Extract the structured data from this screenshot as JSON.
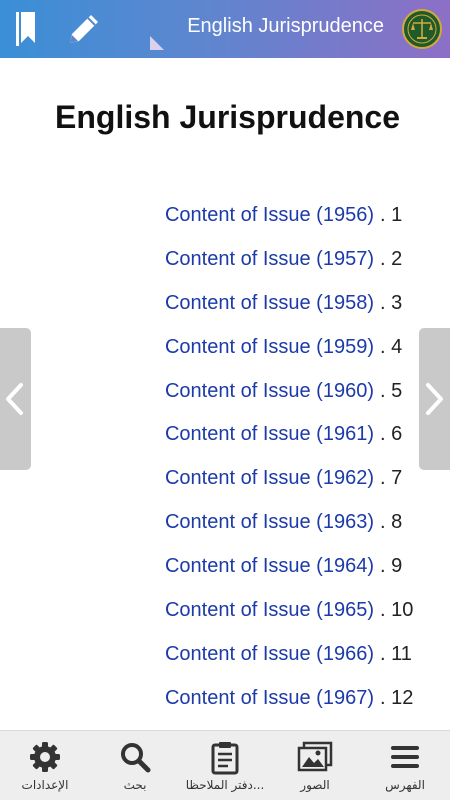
{
  "header": {
    "title": "English Jurisprudence",
    "bookmark_icon": "bookmark-icon",
    "edit_icon": "pencil-icon",
    "logo_icon": "scales-of-justice-logo"
  },
  "main": {
    "heading": "English Jurisprudence",
    "items": [
      {
        "num": ". 1",
        "label": "Content of Issue (1956)"
      },
      {
        "num": ". 2",
        "label": "Content of Issue (1957)"
      },
      {
        "num": ". 3",
        "label": "Content of Issue (1958)"
      },
      {
        "num": ". 4",
        "label": "Content of Issue (1959)"
      },
      {
        "num": ". 5",
        "label": "Content of Issue (1960)"
      },
      {
        "num": ". 6",
        "label": "Content of Issue (1961)"
      },
      {
        "num": ". 7",
        "label": "Content of Issue (1962)"
      },
      {
        "num": ". 8",
        "label": "Content of Issue (1963)"
      },
      {
        "num": ". 9",
        "label": "Content of Issue (1964)"
      },
      {
        "num": ". 10",
        "label": "Content of Issue (1965)"
      },
      {
        "num": ". 11",
        "label": "Content of Issue (1966)"
      },
      {
        "num": ". 12",
        "label": "Content of Issue (1967)"
      }
    ]
  },
  "side_nav": {
    "prev_icon": "chevron-left-icon",
    "next_icon": "chevron-right-icon"
  },
  "bottom_nav": {
    "settings": "الإعدادات",
    "search": "بحث",
    "notebook": "دفتر الملاحظا...",
    "images": "الصور",
    "index": "الفهرس"
  },
  "colors": {
    "header_gradient_start": "#3a8fd6",
    "header_gradient_end": "#8d6fc6",
    "link": "#1c3aa9",
    "icon": "#333333"
  }
}
